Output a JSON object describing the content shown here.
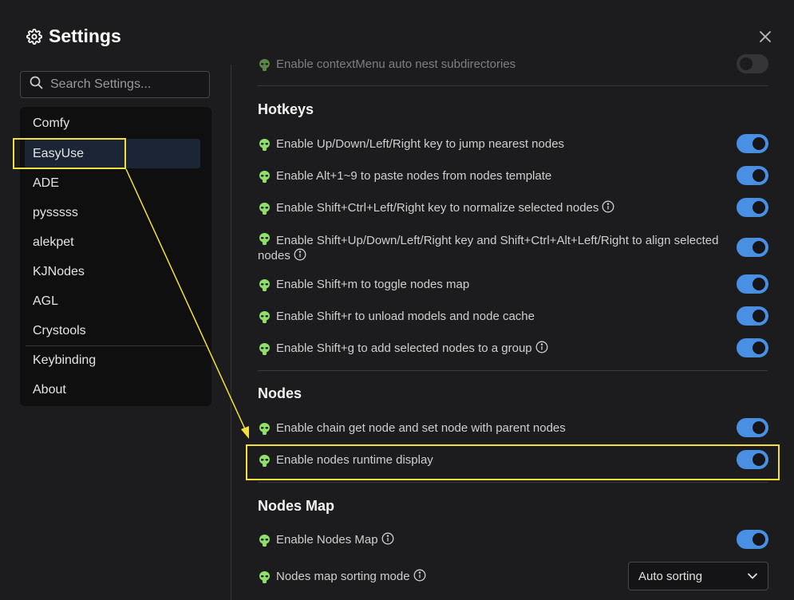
{
  "dialog": {
    "title": "Settings",
    "icon": "gear-icon",
    "close_icon": "close-icon"
  },
  "search": {
    "placeholder": "Search Settings...",
    "icon": "search-icon"
  },
  "sidebar": {
    "items": [
      {
        "label": "Comfy"
      },
      {
        "label": "EasyUse",
        "active": true
      },
      {
        "label": "ADE"
      },
      {
        "label": "pysssss"
      },
      {
        "label": "alekpet"
      },
      {
        "label": "KJNodes"
      },
      {
        "label": "AGL"
      },
      {
        "label": "Crystools"
      },
      {
        "label": "Keybinding"
      },
      {
        "label": "About"
      }
    ]
  },
  "content": {
    "partial_row": {
      "label": "Enable contextMenu auto nest subdirectories",
      "value": false
    },
    "hotkeys": {
      "title": "Hotkeys",
      "rows": [
        {
          "label": "Enable Up/Down/Left/Right key to jump nearest nodes",
          "value": true
        },
        {
          "label": "Enable Alt+1~9 to paste nodes from nodes template",
          "value": true
        },
        {
          "label": "Enable Shift+Ctrl+Left/Right key to normalize selected nodes",
          "value": true,
          "info": true
        },
        {
          "label": "Enable Shift+Up/Down/Left/Right key and Shift+Ctrl+Alt+Left/Right to align selected nodes",
          "value": true,
          "info": true
        },
        {
          "label": "Enable Shift+m to toggle nodes map",
          "value": true
        },
        {
          "label": "Enable Shift+r to unload models and node cache",
          "value": true
        },
        {
          "label": "Enable Shift+g to add selected nodes to a group",
          "value": true,
          "info": true
        }
      ]
    },
    "nodes": {
      "title": "Nodes",
      "rows": [
        {
          "label": "Enable chain get node and set node with parent nodes",
          "value": true
        },
        {
          "label": "Enable nodes runtime display",
          "value": true
        }
      ]
    },
    "nodes_map": {
      "title": "Nodes Map",
      "rows": [
        {
          "label": "Enable Nodes Map",
          "value": true,
          "info": true
        },
        {
          "label": "Nodes map sorting mode",
          "info": true,
          "select_value": "Auto sorting"
        }
      ]
    }
  },
  "colors": {
    "accent": "#4a90e2",
    "highlight": "#f4e03a",
    "alien_icon": "#8ee06a",
    "active_sidebar": "#1b2535"
  }
}
